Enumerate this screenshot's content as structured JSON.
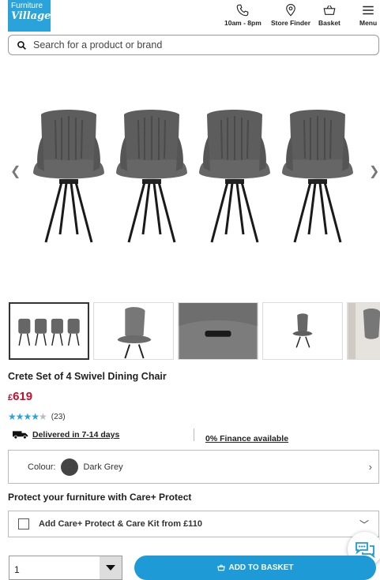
{
  "header": {
    "logo_line1": "Furniture",
    "logo_line2": "Village",
    "hours_label": "10am - 8pm",
    "store_label": "Store Finder",
    "basket_label": "Basket",
    "menu_label": "Menu"
  },
  "search": {
    "placeholder": "Search for a product or brand"
  },
  "product": {
    "title": "Crete Set of 4 Swivel Dining Chair",
    "currency": "£",
    "price": "619",
    "rating": 4.5,
    "review_count": "(23)",
    "delivery": "Delivered in 7-14 days",
    "finance": "0% Finance available",
    "thumbnails": 5,
    "active_thumbnail": 1
  },
  "colour": {
    "label": "Colour:",
    "value": "Dark Grey",
    "swatch": "#444444"
  },
  "protect": {
    "heading": "Protect your furniture with Care+ Protect",
    "option": "Add Care+ Protect & Care Kit from £110"
  },
  "purchase": {
    "quantity": "1",
    "button": "ADD TO BASKET"
  },
  "colors": {
    "brand_blue": "#1e9ad6",
    "price_red": "#c8102e",
    "star_blue": "#29a3d9"
  }
}
